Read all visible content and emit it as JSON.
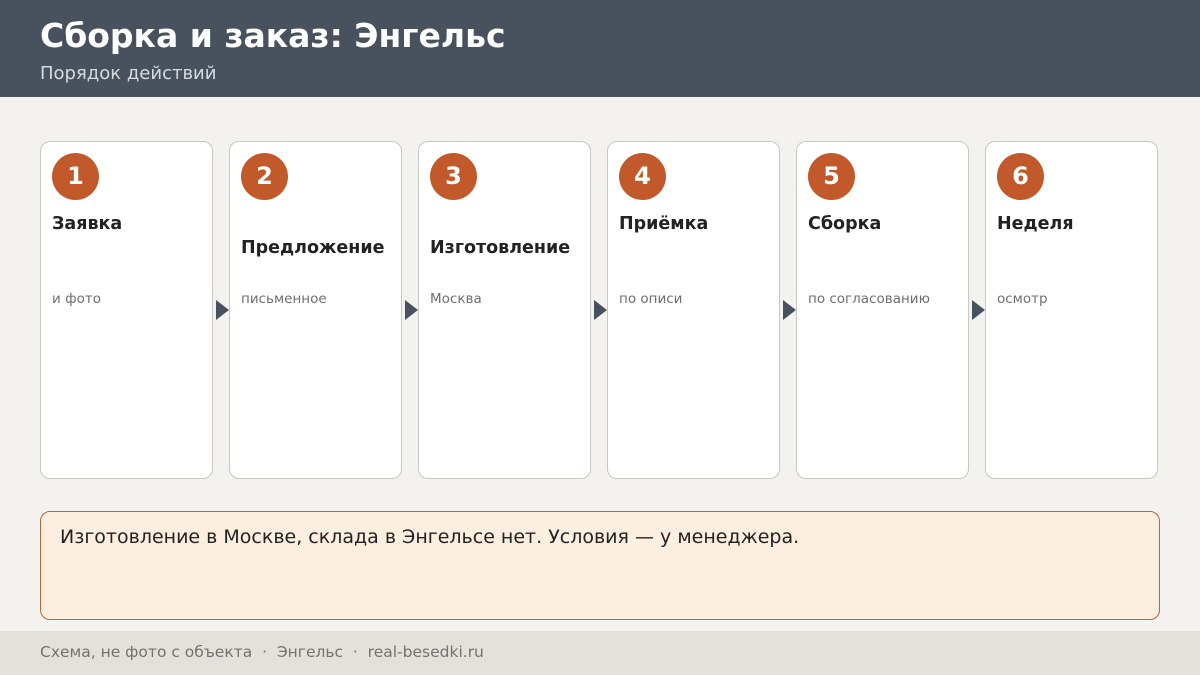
{
  "header": {
    "title": "Сборка и заказ: Энгельс",
    "subtitle": "Порядок действий"
  },
  "steps": [
    {
      "number": "1",
      "title": "Заявка",
      "text": "и фото"
    },
    {
      "number": "2",
      "title": "Предложение",
      "text": "письменное"
    },
    {
      "number": "3",
      "title": "Изготовление",
      "text": "Москва"
    },
    {
      "number": "4",
      "title": "Приёмка",
      "text": "по описи"
    },
    {
      "number": "5",
      "title": "Сборка",
      "text": "по согласованию"
    },
    {
      "number": "6",
      "title": "Неделя",
      "text": "осмотр"
    }
  ],
  "note": {
    "text": "Изготовление в Москве, склада в Энгельсе нет. Условия — у менеджера."
  },
  "footer": {
    "text": "Схема, не фото с объекта  ·  Энгельс  ·  real-besedki.ru"
  },
  "colors": {
    "header_bg": "#48525e",
    "accent": "#c1592a",
    "note_bg": "#fdefdf",
    "note_border": "#b9653a",
    "page_bg": "#f3f2ee"
  }
}
